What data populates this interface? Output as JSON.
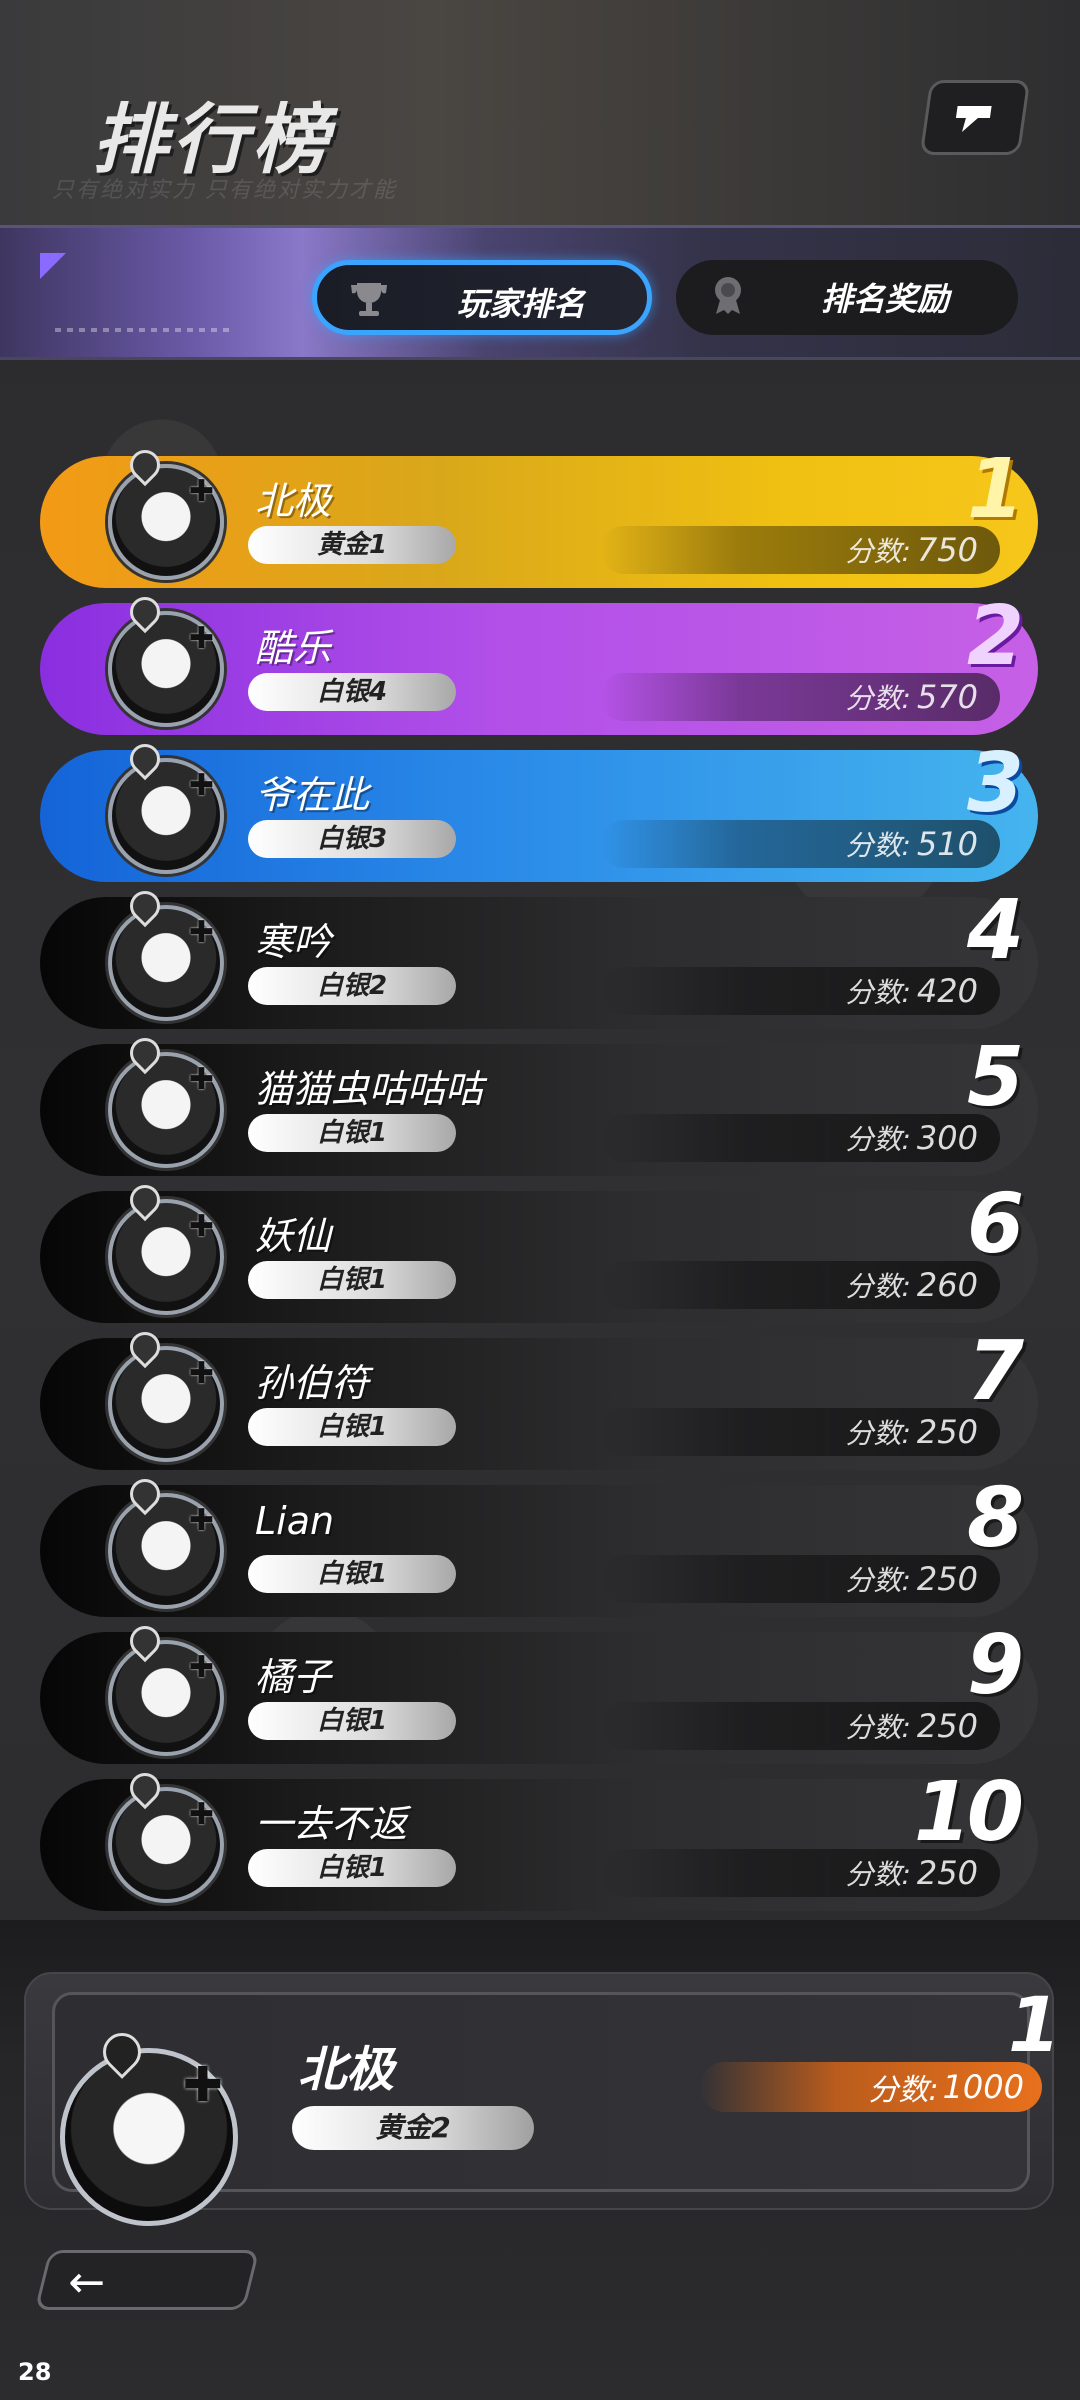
{
  "header": {
    "title": "排行榜",
    "subtitle_faint": "只有绝对实力    只有绝对实力才能"
  },
  "tabs": [
    {
      "label": "玩家排名",
      "icon": "trophy-icon",
      "active": true
    },
    {
      "label": "排名奖励",
      "icon": "medal-icon",
      "active": false
    }
  ],
  "ranking": [
    {
      "rank": "1",
      "name": "北极",
      "tier": "黄金1",
      "score_label": "分数:",
      "score": "750"
    },
    {
      "rank": "2",
      "name": "酷乐",
      "tier": "白银4",
      "score_label": "分数:",
      "score": "570"
    },
    {
      "rank": "3",
      "name": "爷在此",
      "tier": "白银3",
      "score_label": "分数:",
      "score": "510"
    },
    {
      "rank": "4",
      "name": "寒吟",
      "tier": "白银2",
      "score_label": "分数:",
      "score": "420"
    },
    {
      "rank": "5",
      "name": "猫猫虫咕咕咕",
      "tier": "白银1",
      "score_label": "分数:",
      "score": "300"
    },
    {
      "rank": "6",
      "name": "妖仙",
      "tier": "白银1",
      "score_label": "分数:",
      "score": "260"
    },
    {
      "rank": "7",
      "name": "孙伯符",
      "tier": "白银1",
      "score_label": "分数:",
      "score": "250"
    },
    {
      "rank": "8",
      "name": "Lian",
      "tier": "白银1",
      "score_label": "分数:",
      "score": "250"
    },
    {
      "rank": "9",
      "name": "橘子",
      "tier": "白银1",
      "score_label": "分数:",
      "score": "250"
    },
    {
      "rank": "10",
      "name": "一去不返",
      "tier": "白银1",
      "score_label": "分数:",
      "score": "250"
    }
  ],
  "my_entry": {
    "rank": "1",
    "name": "北极",
    "tier": "黄金2",
    "score_label": "分数:",
    "score": "1000"
  },
  "footer": {
    "page_number": "28"
  },
  "colors": {
    "accent_blue": "#3aa4ff",
    "gold": "#f0c012",
    "purple": "#b14fe8",
    "blue": "#2a8ae8",
    "orange_score": "#e8701c"
  }
}
